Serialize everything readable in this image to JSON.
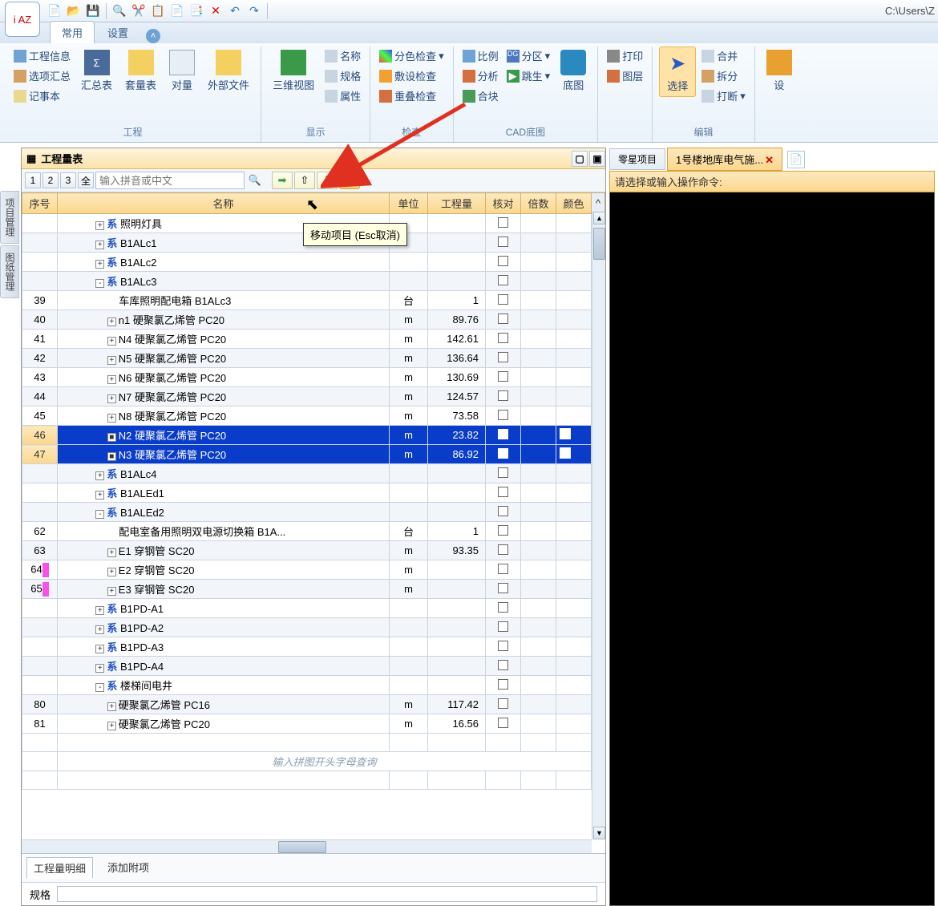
{
  "title_path": "C:\\Users\\Z",
  "app_logo": "i AZ",
  "ribbon_tabs": {
    "t1": "常用",
    "t2": "设置"
  },
  "g_project": {
    "title": "工程",
    "b1": "工程信息",
    "b2": "选项汇总",
    "b3": "记事本",
    "b4": "汇总表",
    "b5": "套量表",
    "b6": "对量",
    "b7": "外部文件"
  },
  "g_display": {
    "title": "显示",
    "b1": "三维视图",
    "b2": "名称",
    "b3": "规格",
    "b4": "属性"
  },
  "g_check": {
    "title": "检查",
    "b1": "分色检查",
    "b2": "敷设检查",
    "b3": "重叠检查"
  },
  "g_cad": {
    "title": "CAD底图",
    "b1": "比例",
    "b2": "分析",
    "b3": "合块",
    "b4": "分区",
    "b5": "跳生",
    "b6": "底图"
  },
  "g_print": {
    "b1": "打印",
    "b2": "图层"
  },
  "g_edit": {
    "title": "编辑",
    "b1": "选择",
    "b2": "合并",
    "b3": "拆分",
    "b4": "打断"
  },
  "pane_title": "工程量表",
  "lvl": {
    "l1": "1",
    "l2": "2",
    "l3": "3",
    "all": "全"
  },
  "search_ph": "输入拼音或中文",
  "move_btn": "移",
  "tooltip": "移动项目 (Esc取消)",
  "cols": {
    "seq": "序号",
    "name": "名称",
    "unit": "单位",
    "qty": "工程量",
    "check": "核对",
    "mult": "倍数",
    "color": "颜色"
  },
  "rows": [
    {
      "seq": "",
      "ind": 3,
      "exp": "+",
      "sys": true,
      "name": "照明灯具",
      "unit": "",
      "qty": "",
      "sel": false
    },
    {
      "seq": "",
      "ind": 3,
      "exp": "+",
      "sys": true,
      "name": "B1ALc1",
      "unit": "",
      "qty": "",
      "sel": false
    },
    {
      "seq": "",
      "ind": 3,
      "exp": "+",
      "sys": true,
      "name": "B1ALc2",
      "unit": "",
      "qty": "",
      "sel": false
    },
    {
      "seq": "",
      "ind": 3,
      "exp": "-",
      "sys": true,
      "name": "B1ALc3",
      "unit": "",
      "qty": "",
      "sel": false
    },
    {
      "seq": "39",
      "ind": 5,
      "exp": "",
      "sys": false,
      "name": "车库照明配电箱 B1ALc3",
      "unit": "台",
      "qty": "1",
      "sel": false
    },
    {
      "seq": "40",
      "ind": 4,
      "exp": "+",
      "sys": false,
      "name": "n1 硬聚氯乙烯管 PC20",
      "unit": "m",
      "qty": "89.76",
      "sel": false
    },
    {
      "seq": "41",
      "ind": 4,
      "exp": "+",
      "sys": false,
      "name": "N4 硬聚氯乙烯管 PC20",
      "unit": "m",
      "qty": "142.61",
      "sel": false
    },
    {
      "seq": "42",
      "ind": 4,
      "exp": "+",
      "sys": false,
      "name": "N5 硬聚氯乙烯管 PC20",
      "unit": "m",
      "qty": "136.64",
      "sel": false
    },
    {
      "seq": "43",
      "ind": 4,
      "exp": "+",
      "sys": false,
      "name": "N6 硬聚氯乙烯管 PC20",
      "unit": "m",
      "qty": "130.69",
      "sel": false
    },
    {
      "seq": "44",
      "ind": 4,
      "exp": "+",
      "sys": false,
      "name": "N7 硬聚氯乙烯管 PC20",
      "unit": "m",
      "qty": "124.57",
      "sel": false
    },
    {
      "seq": "45",
      "ind": 4,
      "exp": "+",
      "sys": false,
      "name": "N8 硬聚氯乙烯管 PC20",
      "unit": "m",
      "qty": "73.58",
      "sel": false
    },
    {
      "seq": "46",
      "ind": 4,
      "exp": "■",
      "sys": false,
      "name": "N2 硬聚氯乙烯管 PC20",
      "unit": "m",
      "qty": "23.82",
      "sel": true
    },
    {
      "seq": "47",
      "ind": 4,
      "exp": "■",
      "sys": false,
      "name": "N3 硬聚氯乙烯管 PC20",
      "unit": "m",
      "qty": "86.92",
      "sel": true
    },
    {
      "seq": "",
      "ind": 3,
      "exp": "+",
      "sys": true,
      "name": "B1ALc4",
      "unit": "",
      "qty": "",
      "sel": false
    },
    {
      "seq": "",
      "ind": 3,
      "exp": "+",
      "sys": true,
      "name": "B1ALEd1",
      "unit": "",
      "qty": "",
      "sel": false
    },
    {
      "seq": "",
      "ind": 3,
      "exp": "-",
      "sys": true,
      "name": "B1ALEd2",
      "unit": "",
      "qty": "",
      "sel": false
    },
    {
      "seq": "62",
      "ind": 5,
      "exp": "",
      "sys": false,
      "name": "配电室备用照明双电源切换箱 B1A...",
      "unit": "台",
      "qty": "1",
      "sel": false
    },
    {
      "seq": "63",
      "ind": 4,
      "exp": "+",
      "sys": false,
      "name": "E1 穿钢管 SC20",
      "unit": "m",
      "qty": "93.35",
      "sel": false
    },
    {
      "seq": "64",
      "ind": 4,
      "exp": "+",
      "sys": false,
      "name": "E2 穿钢管 SC20",
      "unit": "m",
      "qty": "",
      "sel": false,
      "mark": true
    },
    {
      "seq": "65",
      "ind": 4,
      "exp": "+",
      "sys": false,
      "name": "E3 穿钢管 SC20",
      "unit": "m",
      "qty": "",
      "sel": false,
      "mark": true
    },
    {
      "seq": "",
      "ind": 3,
      "exp": "+",
      "sys": true,
      "name": "B1PD-A1",
      "unit": "",
      "qty": "",
      "sel": false
    },
    {
      "seq": "",
      "ind": 3,
      "exp": "+",
      "sys": true,
      "name": "B1PD-A2",
      "unit": "",
      "qty": "",
      "sel": false
    },
    {
      "seq": "",
      "ind": 3,
      "exp": "+",
      "sys": true,
      "name": "B1PD-A3",
      "unit": "",
      "qty": "",
      "sel": false
    },
    {
      "seq": "",
      "ind": 3,
      "exp": "+",
      "sys": true,
      "name": "B1PD-A4",
      "unit": "",
      "qty": "",
      "sel": false
    },
    {
      "seq": "",
      "ind": 3,
      "exp": "-",
      "sys": true,
      "name": "楼梯间电井",
      "unit": "",
      "qty": "",
      "sel": false
    },
    {
      "seq": "80",
      "ind": 4,
      "exp": "+",
      "sys": false,
      "name": "硬聚氯乙烯管 PC16",
      "unit": "m",
      "qty": "117.42",
      "sel": false
    },
    {
      "seq": "81",
      "ind": 4,
      "exp": "+",
      "sys": false,
      "name": "硬聚氯乙烯管 PC20",
      "unit": "m",
      "qty": "16.56",
      "sel": false
    }
  ],
  "hint_text": "输入拼图开头字母查询",
  "btabs": {
    "t1": "工程量明细",
    "t2": "添加附项"
  },
  "side": {
    "t1": "项目管理",
    "t2": "图纸管理"
  },
  "rp": {
    "tab1": "零星项目",
    "tab2": "1号楼地库电气施...",
    "cmd": "请选择或输入操作命令:"
  },
  "bottom_label": "规格"
}
